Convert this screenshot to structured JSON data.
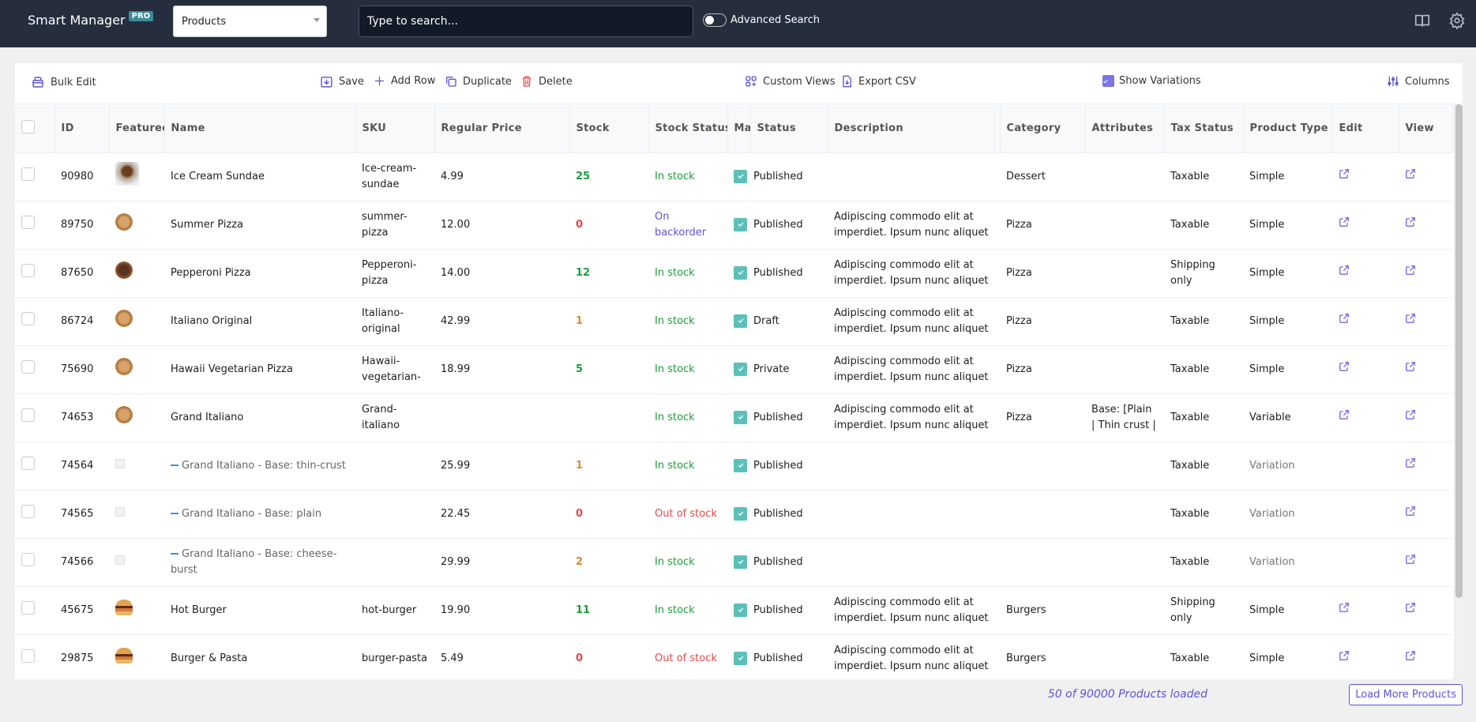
{
  "header": {
    "brand": "Smart Manager",
    "brand_badge": "PRO",
    "dashboard_select": "Products",
    "search_placeholder": "Type to search...",
    "advanced_search_label": "Advanced Search",
    "advanced_search_enabled": false,
    "icons": [
      "book-icon",
      "gear-icon"
    ]
  },
  "toolbar": {
    "bulk_edit": "Bulk Edit",
    "save": "Save",
    "add_row": "Add Row",
    "duplicate": "Duplicate",
    "delete": "Delete",
    "custom_views": "Custom Views",
    "export_csv": "Export CSV",
    "show_variations": "Show Variations",
    "show_variations_checked": true,
    "columns": "Columns"
  },
  "table": {
    "columns": [
      "",
      "ID",
      "Featured",
      "Name",
      "SKU",
      "Regular Price",
      "Stock",
      "Stock Status",
      "Ma",
      "Status",
      "Description",
      "Category",
      "Attributes",
      "Tax Status",
      "Product Type",
      "Edit",
      "View"
    ],
    "rows": [
      {
        "id": "90980",
        "img": "sundae",
        "name": "Ice Cream Sundae",
        "sku": "Ice-cream-sundae",
        "price": "4.99",
        "stock": "25",
        "stock_color": "green",
        "stock_status": "In stock",
        "status": "Published",
        "description": "",
        "category": "Dessert",
        "attributes": "",
        "tax_status": "Taxable",
        "product_type": "Simple",
        "variation": false
      },
      {
        "id": "89750",
        "img": "pizza",
        "name": "Summer Pizza",
        "sku": "summer-pizza",
        "price": "12.00",
        "stock": "0",
        "stock_color": "red",
        "stock_status": "On backorder",
        "status": "Published",
        "description": "Adipiscing commodo elit at imperdiet. Ipsum nunc aliquet",
        "category": "Pizza",
        "attributes": "",
        "tax_status": "Taxable",
        "product_type": "Simple",
        "variation": false
      },
      {
        "id": "87650",
        "img": "pizza-dark",
        "name": "Pepperoni Pizza",
        "sku": "Pepperoni-pizza",
        "price": "14.00",
        "stock": "12",
        "stock_color": "green",
        "stock_status": "In stock",
        "status": "Published",
        "description": "Adipiscing commodo elit at imperdiet. Ipsum nunc aliquet",
        "category": "Pizza",
        "attributes": "",
        "tax_status": "Shipping only",
        "product_type": "Simple",
        "variation": false
      },
      {
        "id": "86724",
        "img": "pizza",
        "name": "Italiano Original",
        "sku": "Italiano-original",
        "price": "42.99",
        "stock": "1",
        "stock_color": "orange",
        "stock_status": "In stock",
        "status": "Draft",
        "description": "Adipiscing commodo elit at imperdiet. Ipsum nunc aliquet",
        "category": "Pizza",
        "attributes": "",
        "tax_status": "Taxable",
        "product_type": "Simple",
        "variation": false
      },
      {
        "id": "75690",
        "img": "pizza",
        "name": "Hawaii Vegetarian Pizza",
        "sku": "Hawaii-vegetarian-",
        "price": "18.99",
        "stock": "5",
        "stock_color": "green",
        "stock_status": "In stock",
        "status": "Private",
        "description": "Adipiscing commodo elit at imperdiet. Ipsum nunc aliquet",
        "category": "Pizza",
        "attributes": "",
        "tax_status": "Taxable",
        "product_type": "Simple",
        "variation": false
      },
      {
        "id": "74653",
        "img": "pizza",
        "name": "Grand Italiano",
        "sku": "Grand-italiano",
        "price": "",
        "stock": "",
        "stock_color": "",
        "stock_status": "In stock",
        "status": "Published",
        "description": "Adipiscing commodo elit at imperdiet. Ipsum nunc aliquet",
        "category": "Pizza",
        "attributes": "Base: [Plain | Thin crust |",
        "tax_status": "Taxable",
        "product_type": "Variable",
        "variation": false
      },
      {
        "id": "74564",
        "img": "placeholder",
        "name": "Grand Italiano - Base: thin-crust",
        "sku": "",
        "price": "25.99",
        "stock": "1",
        "stock_color": "orange",
        "stock_status": "In stock",
        "status": "Published",
        "description": "",
        "category": "",
        "attributes": "",
        "tax_status": "Taxable",
        "product_type": "Variation",
        "variation": true
      },
      {
        "id": "74565",
        "img": "placeholder",
        "name": "Grand Italiano - Base: plain",
        "sku": "",
        "price": "22.45",
        "stock": "0",
        "stock_color": "red",
        "stock_status": "Out of stock",
        "status": "Published",
        "description": "",
        "category": "",
        "attributes": "",
        "tax_status": "Taxable",
        "product_type": "Variation",
        "variation": true
      },
      {
        "id": "74566",
        "img": "placeholder",
        "name": "Grand Italiano - Base: cheese-burst",
        "sku": "",
        "price": "29.99",
        "stock": "2",
        "stock_color": "orange",
        "stock_status": "In stock",
        "status": "Published",
        "description": "",
        "category": "",
        "attributes": "",
        "tax_status": "Taxable",
        "product_type": "Variation",
        "variation": true
      },
      {
        "id": "45675",
        "img": "burger",
        "name": "Hot Burger",
        "sku": "hot-burger",
        "price": "19.90",
        "stock": "11",
        "stock_color": "green",
        "stock_status": "In stock",
        "status": "Published",
        "description": "Adipiscing commodo elit at imperdiet. Ipsum nunc aliquet",
        "category": "Burgers",
        "attributes": "",
        "tax_status": "Shipping only",
        "product_type": "Simple",
        "variation": false
      },
      {
        "id": "29875",
        "img": "burger",
        "name": "Burger & Pasta",
        "sku": "burger-pasta",
        "price": "5.49",
        "stock": "0",
        "stock_color": "red",
        "stock_status": "Out of stock",
        "status": "Published",
        "description": "Adipiscing commodo elit at imperdiet. Ipsum nunc aliquet",
        "category": "Burgers",
        "attributes": "",
        "tax_status": "Taxable",
        "product_type": "Simple",
        "variation": false
      }
    ]
  },
  "footer": {
    "loaded_text": "50 of 90000 Products loaded",
    "load_more": "Load More Products"
  },
  "colors": {
    "header_bg": "#262e3e",
    "accent": "#5b55d9",
    "status_check": "#5cc0b8",
    "in_stock": "#1c9e3a",
    "out_of_stock": "#e54848",
    "low_stock": "#e0892b"
  }
}
